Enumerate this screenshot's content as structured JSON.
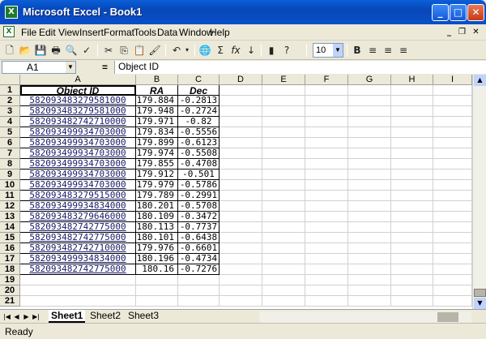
{
  "app": {
    "title": "Microsoft Excel - Book1",
    "icon": "excel-icon"
  },
  "menu": [
    "File",
    "Edit",
    "View",
    "Insert",
    "Format",
    "Tools",
    "Data",
    "Window",
    "Help"
  ],
  "toolbar": {
    "font_size": "10"
  },
  "formula_bar": {
    "name_box": "A1",
    "equals": "=",
    "value": "Object ID"
  },
  "columns": [
    "A",
    "B",
    "C",
    "D",
    "E",
    "F",
    "G",
    "H",
    "I"
  ],
  "row_numbers": [
    "1",
    "2",
    "3",
    "4",
    "5",
    "6",
    "7",
    "8",
    "9",
    "10",
    "11",
    "12",
    "13",
    "14",
    "15",
    "16",
    "17",
    "18",
    "19",
    "20",
    "21"
  ],
  "table": {
    "headers": [
      "Object ID",
      "RA",
      "Dec"
    ],
    "rows": [
      [
        "582093483279581000",
        "179.884",
        "-0.2813"
      ],
      [
        "582093483279581000",
        "179.948",
        "-0.2724"
      ],
      [
        "582093482742710000",
        "179.971",
        "-0.82"
      ],
      [
        "582093499934703000",
        "179.834",
        "-0.5556"
      ],
      [
        "582093499934703000",
        "179.899",
        "-0.6123"
      ],
      [
        "582093499934703000",
        "179.974",
        "-0.5508"
      ],
      [
        "582093499934703000",
        "179.855",
        "-0.4708"
      ],
      [
        "582093499934703000",
        "179.912",
        "-0.501"
      ],
      [
        "582093499934703000",
        "179.979",
        "-0.5786"
      ],
      [
        "582093483279515000",
        "179.789",
        "-0.2991"
      ],
      [
        "582093499934834000",
        "180.201",
        "-0.5708"
      ],
      [
        "582093483279646000",
        "180.109",
        "-0.3472"
      ],
      [
        "582093482742775000",
        "180.113",
        "-0.7737"
      ],
      [
        "582093482742775000",
        "180.101",
        "-0.6438"
      ],
      [
        "582093482742710000",
        "179.976",
        "-0.6601"
      ],
      [
        "582093499934834000",
        "180.196",
        "-0.4734"
      ],
      [
        "582093482742775000",
        "180.16",
        "-0.7276"
      ]
    ]
  },
  "sheets": [
    "Sheet1",
    "Sheet2",
    "Sheet3"
  ],
  "status": "Ready"
}
